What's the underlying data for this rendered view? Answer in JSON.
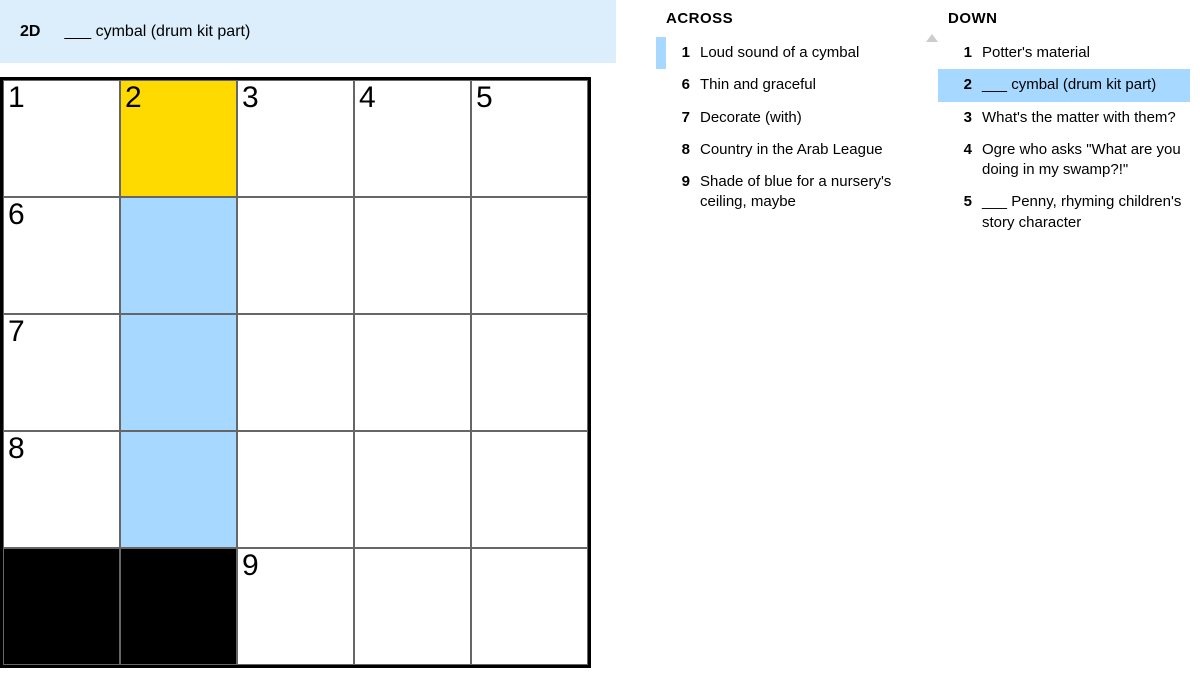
{
  "clue_bar": {
    "number": "2D",
    "text": "___ cymbal (drum kit part)"
  },
  "grid": {
    "rows": 5,
    "cols": 5,
    "cells": [
      [
        {
          "n": "1"
        },
        {
          "n": "2",
          "state": "focus"
        },
        {
          "n": "3"
        },
        {
          "n": "4"
        },
        {
          "n": "5"
        }
      ],
      [
        {
          "n": "6"
        },
        {
          "state": "hl"
        },
        {},
        {},
        {}
      ],
      [
        {
          "n": "7"
        },
        {
          "state": "hl"
        },
        {},
        {},
        {}
      ],
      [
        {
          "n": "8"
        },
        {
          "state": "hl"
        },
        {},
        {},
        {}
      ],
      [
        {
          "state": "black"
        },
        {
          "state": "black"
        },
        {
          "n": "9"
        },
        {},
        {}
      ]
    ]
  },
  "clues": {
    "across": {
      "heading": "ACROSS",
      "items": [
        {
          "n": "1",
          "t": "Loud sound of a cymbal",
          "state": "related"
        },
        {
          "n": "6",
          "t": "Thin and graceful"
        },
        {
          "n": "7",
          "t": "Decorate (with)"
        },
        {
          "n": "8",
          "t": "Country in the Arab League"
        },
        {
          "n": "9",
          "t": "Shade of blue for a nursery's ceiling, maybe"
        }
      ]
    },
    "down": {
      "heading": "DOWN",
      "items": [
        {
          "n": "1",
          "t": "Potter's material"
        },
        {
          "n": "2",
          "t": "___ cymbal (drum kit part)",
          "state": "selected"
        },
        {
          "n": "3",
          "t": "What's the matter with them?"
        },
        {
          "n": "4",
          "t": "Ogre who asks \"What are you doing in my swamp?!\""
        },
        {
          "n": "5",
          "t": "___ Penny, rhyming children's story character"
        }
      ]
    }
  }
}
